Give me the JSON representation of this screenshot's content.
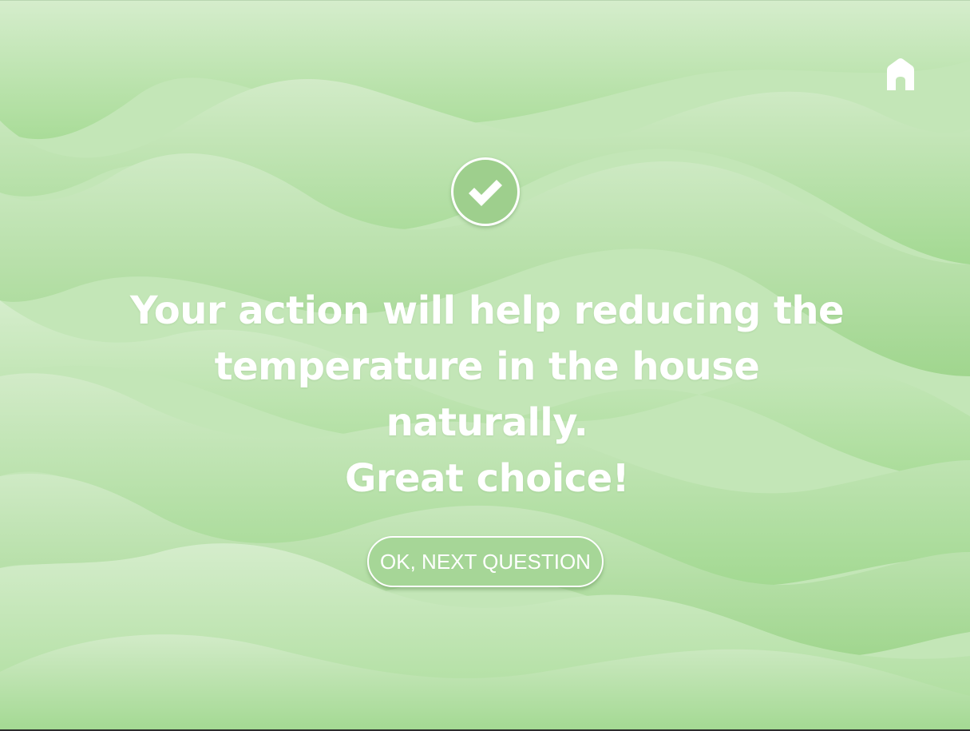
{
  "screen": {
    "message_lines": [
      "Your action will help reducing the",
      "temperature in the house naturally.",
      "Great choice!"
    ],
    "next_button_label": "OK, NEXT QUESTION"
  },
  "icons": {
    "home": "home-icon",
    "check": "checkmark-icon"
  },
  "colors": {
    "background_light": "#d4ecca",
    "background_mid": "#b5e2a8",
    "background_dark": "#9dd48a",
    "badge_fill": "#9ecf8d",
    "button_fill": "#a6d697",
    "text": "#ffffff"
  }
}
